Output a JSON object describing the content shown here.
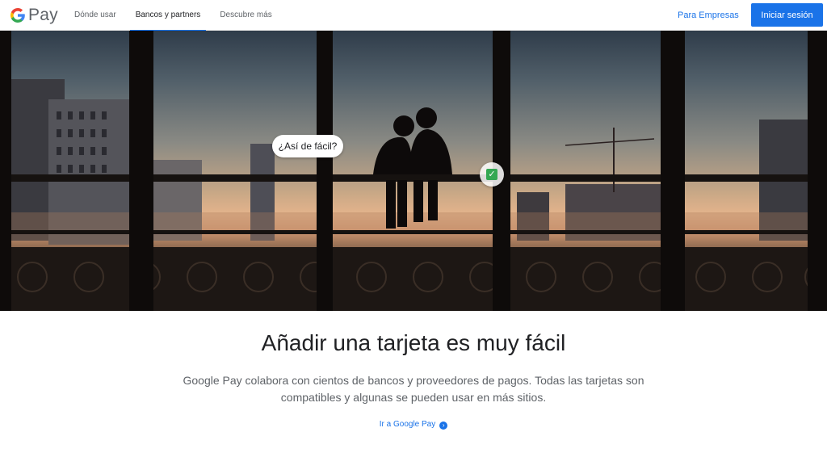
{
  "header": {
    "logo_text": "Pay",
    "nav": [
      {
        "label": "Dónde usar",
        "active": false
      },
      {
        "label": "Bancos y partners",
        "active": true
      },
      {
        "label": "Descubre más",
        "active": false
      }
    ],
    "business_link": "Para Empresas",
    "signin_label": "Iniciar sesión"
  },
  "hero": {
    "bubble_text": "¿Así de fácil?",
    "check_icon": "check-box-icon"
  },
  "main": {
    "headline": "Añadir una tarjeta es muy fácil",
    "description": "Google Pay colabora con cientos de bancos y proveedores de pagos. Todas las tarjetas son compatibles y algunas se pueden usar en más sitios.",
    "cta_label": "Ir a Google Pay"
  },
  "colors": {
    "accent": "#1a73e8",
    "text_primary": "#202124",
    "text_secondary": "#5f6368"
  }
}
